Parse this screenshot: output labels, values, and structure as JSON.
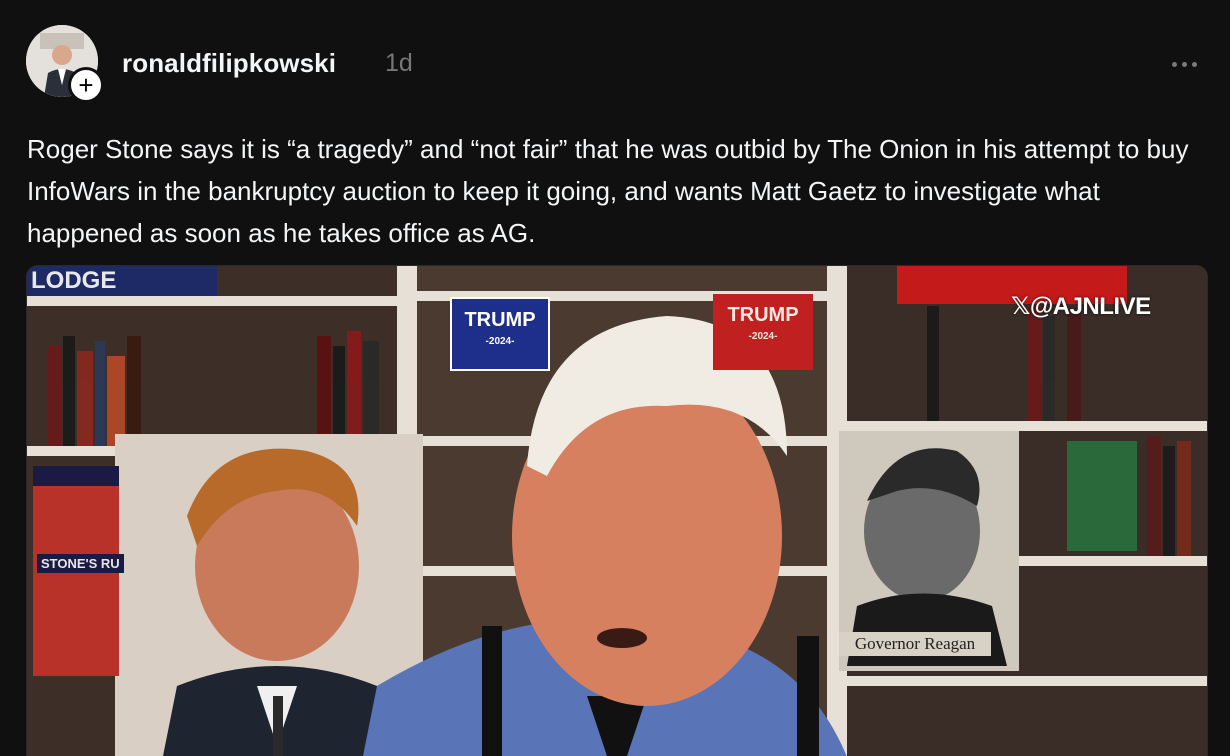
{
  "post": {
    "username": "ronaldfilipkowski",
    "time": "1d",
    "follow_symbol": "+",
    "caption": "Roger Stone says it is “a tragedy” and “not fair” that he was outbid by The Onion in his attempt to buy InfoWars in the bankruptcy auction to keep it going, and wants Matt Gaetz to investigate what happened as soon as he takes office as AG."
  },
  "media": {
    "watermark": "@AJNLIVE",
    "signs": {
      "lodge": "LODGE",
      "trump_blue": "TRUMP",
      "trump_blue_sub": "-2024-",
      "trump_red": "TRUMP",
      "trump_red_sub": "-2024-",
      "reagan": "Governor Reagan",
      "stones": "STONE'S RU"
    }
  },
  "icons": {
    "more": "more-horizontal-icon",
    "follow": "plus-icon"
  },
  "colors": {
    "background": "#101010",
    "text_primary": "#f3f5f7",
    "text_secondary": "#777777"
  }
}
